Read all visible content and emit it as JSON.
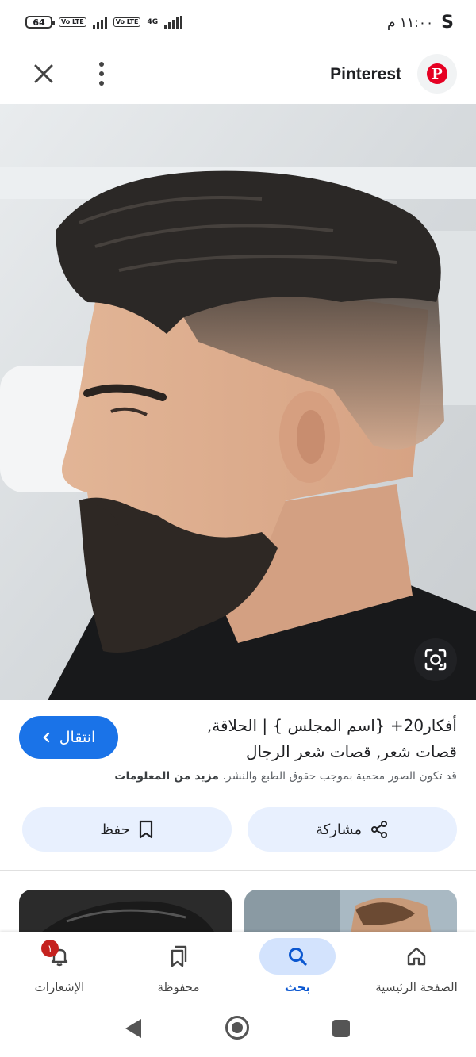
{
  "status_bar": {
    "battery": "64",
    "volte_1": "Vo LTE",
    "volte_2": "Vo LTE",
    "network": "4G",
    "s_icon": "S",
    "time": "١١:٠٠ م"
  },
  "top_bar": {
    "close_icon": "close-icon",
    "menu_icon": "more-vert-icon",
    "site_name": "Pinterest",
    "site_logo": "P"
  },
  "result": {
    "title": "أفكار20+ {اسم المجلس } | الحلاقة, قصات شعر, قصات شعر الرجال",
    "visit_label": "انتقال",
    "copyright_text": "قد تكون الصور محمية بموجب حقوق الطبع والنشر.",
    "more_info": "مزيد من المعلومات",
    "share_label": "مشاركة",
    "save_label": "حفظ"
  },
  "bottom_nav": {
    "items": [
      {
        "label": "الصفحة الرئيسية",
        "icon": "home-icon"
      },
      {
        "label": "بحث",
        "icon": "search-icon",
        "active": true
      },
      {
        "label": "محفوظة",
        "icon": "bookmarks-icon"
      },
      {
        "label": "الإشعارات",
        "icon": "bell-icon",
        "badge": "١"
      }
    ]
  },
  "colors": {
    "accent": "#1a73e8",
    "pill_bg": "#e8f0fe",
    "active_nav_bg": "#d3e3fd",
    "pinterest_red": "#e60023",
    "badge_red": "#c5221f"
  }
}
